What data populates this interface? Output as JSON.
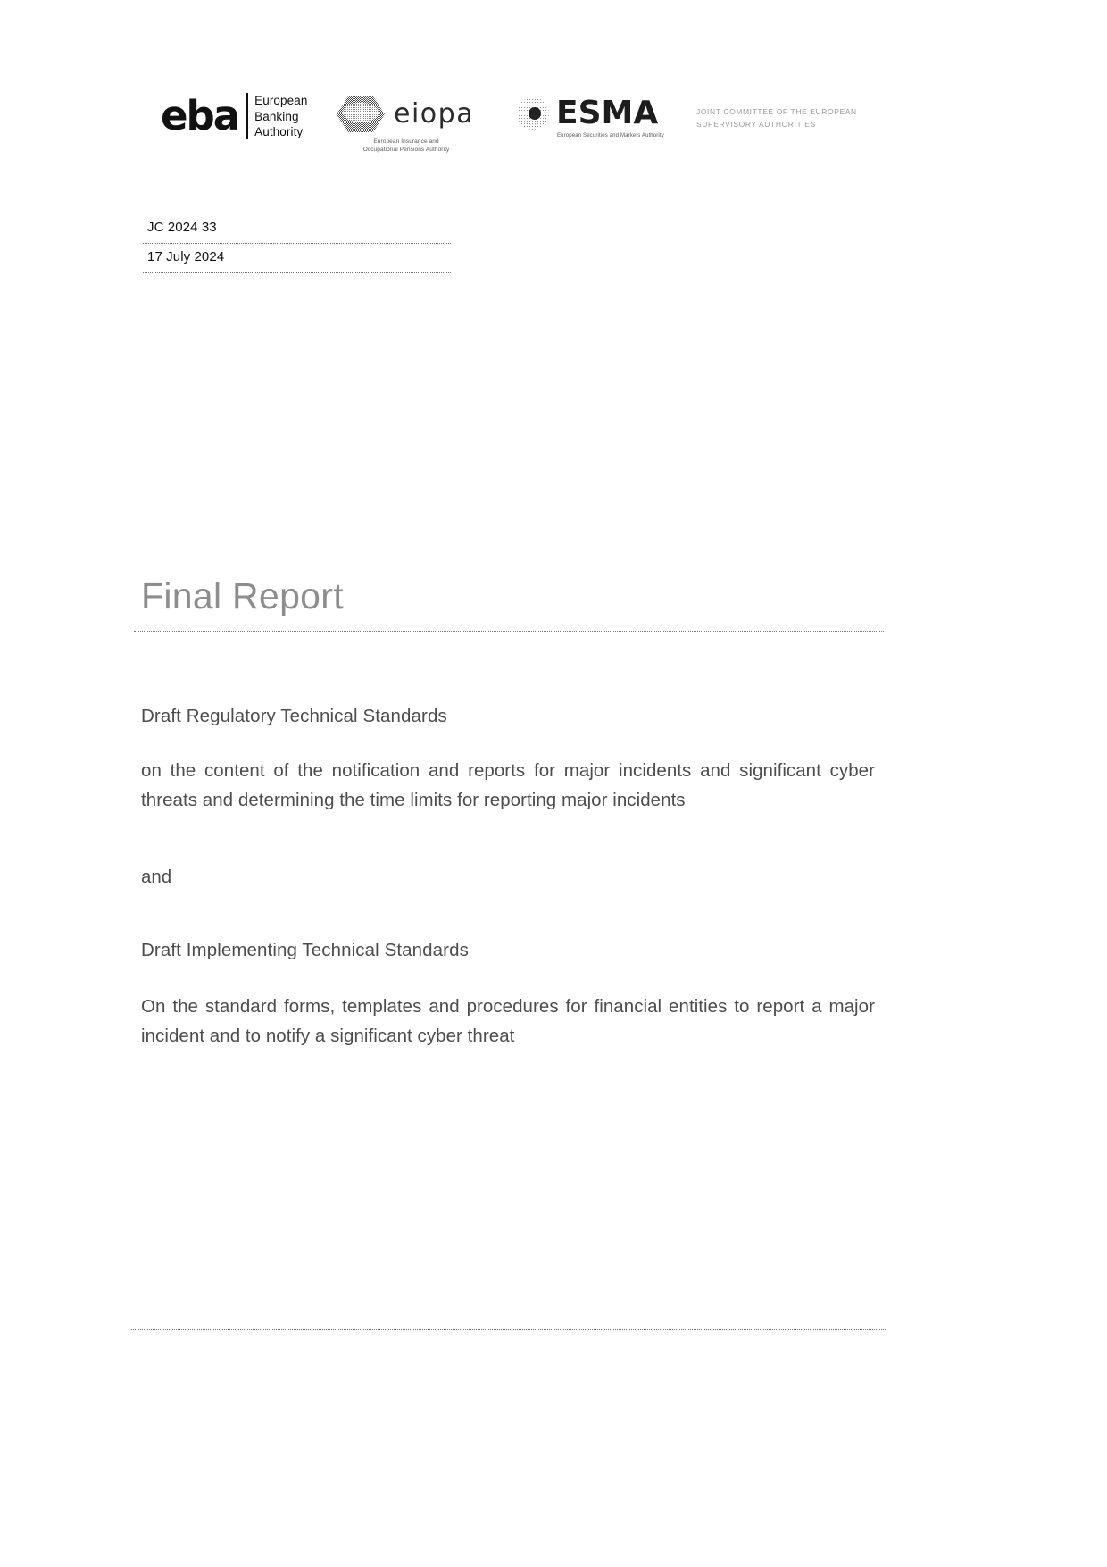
{
  "header": {
    "eba": {
      "mark": "eba",
      "line1": "European",
      "line2": "Banking",
      "line3": "Authority",
      "icon": "eba-logo"
    },
    "eiopa": {
      "wordmark": "eiopa",
      "caption_line1": "European Insurance and",
      "caption_line2": "Occupational Pensions Authority",
      "icon": "eiopa-hexagon-logo"
    },
    "esma": {
      "wordmark": "ESMA",
      "caption": "European Securities and Markets Authority",
      "icon": "esma-circle-logo"
    },
    "joint_committee": {
      "line1": "Joint Committee of the European",
      "line2": "Supervisory Authorities"
    }
  },
  "reference": {
    "doc_number": "JC 2024 33",
    "date": "17 July 2024"
  },
  "title": "Final Report",
  "body": {
    "heading_rts": "Draft Regulatory Technical Standards",
    "paragraph_rts": "on the content of the notification and reports for major incidents and significant cyber threats and determining the time limits for reporting major incidents",
    "conjunction": "and",
    "heading_its": "Draft Implementing Technical Standards",
    "paragraph_its": "On the standard forms, templates and procedures for financial entities to report a major incident and to notify a significant cyber threat"
  },
  "colors": {
    "body_text": "#4d4d4d",
    "title_text": "#8d8d8d",
    "rule": "#6f6f6f",
    "joint_committee_text": "#9a9a9a"
  }
}
